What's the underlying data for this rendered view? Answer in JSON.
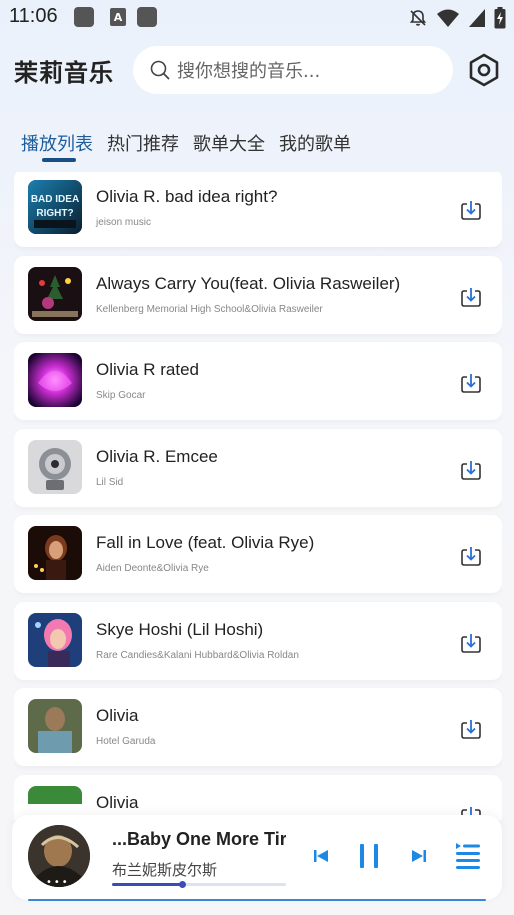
{
  "status_bar": {
    "time": "11:06"
  },
  "header": {
    "app_title": "茉莉音乐",
    "search_placeholder": "搜你想搜的音乐..."
  },
  "tabs": [
    {
      "label": "播放列表",
      "active": true
    },
    {
      "label": "热门推荐",
      "active": false
    },
    {
      "label": "歌单大全",
      "active": false
    },
    {
      "label": "我的歌单",
      "active": false
    }
  ],
  "songs": [
    {
      "title": "Olivia R. bad idea right?",
      "artist": "jeison music",
      "cover_icon": "album-cover-bad-idea-right"
    },
    {
      "title": "Always Carry You(feat. Olivia Rasweiler)",
      "artist": "Kellenberg Memorial High School&Olivia Rasweiler",
      "cover_icon": "album-cover-neon-tree"
    },
    {
      "title": "Olivia R rated",
      "artist": "Skip Gocar",
      "cover_icon": "album-cover-purple-glow"
    },
    {
      "title": "Olivia R. Emcee",
      "artist": "Lil Sid",
      "cover_icon": "album-cover-robot"
    },
    {
      "title": "Fall in Love (feat. Olivia Rye)",
      "artist": "Aiden Deonte&Olivia Rye",
      "cover_icon": "album-cover-candles"
    },
    {
      "title": "Skye Hoshi (Lil Hoshi)",
      "artist": "Rare Candies&Kalani Hubbard&Olivia Roldan",
      "cover_icon": "album-cover-pink-hair"
    },
    {
      "title": "Olivia",
      "artist": "Hotel Garuda",
      "cover_icon": "album-cover-portrait"
    },
    {
      "title": "Olivia",
      "artist": "",
      "cover_icon": "album-cover-flag"
    }
  ],
  "player": {
    "title": "...Baby One More Tir",
    "artist": "布兰妮斯皮尔斯",
    "progress": 0.4,
    "dots": "•••"
  },
  "colors": {
    "accent": "#1e5d9c",
    "player_controls": "#1e88e5",
    "background": "#eef3fb"
  }
}
